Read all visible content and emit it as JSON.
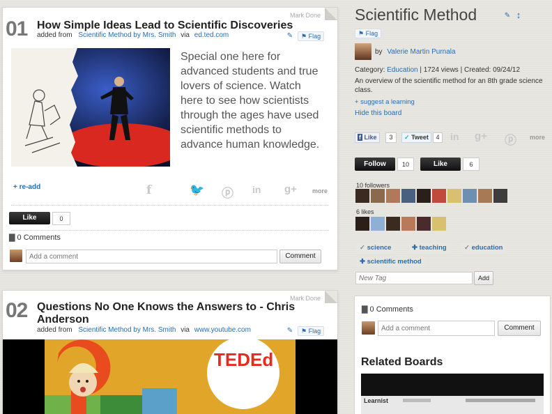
{
  "card1": {
    "mark_done": "Mark Done",
    "number": "01",
    "title": "How Simple Ideas Lead to Scientific Discoveries",
    "added_prefix": "added from",
    "source_board": "Scientific Method by Mrs. Smith",
    "via": "via",
    "source_site": "ed.ted.com",
    "flag": "Flag",
    "description": "Special one here for advanced students and true lovers of science.  Watch here to see how scientists through the ages have used scientific methods to advance human knowledge.",
    "readd": "+ re-add",
    "more": "more",
    "like_label": "Like",
    "like_count": "0",
    "comments": "0 Comments",
    "comment_placeholder": "Add a comment",
    "comment_button": "Comment"
  },
  "card2": {
    "mark_done": "Mark Done",
    "number": "02",
    "title": "Questions No One Knows the Answers to - Chris Anderson",
    "added_prefix": "added from",
    "source_board": "Scientific Method by Mrs. Smith",
    "via": "via",
    "source_site": "www.youtube.com",
    "flag": "Flag",
    "video_logo": "TEDEd"
  },
  "sidebar": {
    "title": "Scientific Method",
    "flag": "Flag",
    "by": "by",
    "author": "Valerie Martin Purnala",
    "category_label": "Category:",
    "category": "Education",
    "views": "| 1724 views | Created: 09/24/12",
    "description": "An overview of the scientific method for an 8th grade science class.",
    "suggest": "+ suggest a learning",
    "hide": "Hide this board",
    "fb_like": "Like",
    "fb_count": "3",
    "tweet": "Tweet",
    "tweet_count": "4",
    "more": "more",
    "follow_label": "Follow",
    "follow_count": "10",
    "like_label": "Like",
    "like_count": "6",
    "followers_label": "10 followers",
    "likes_label": "6 likes",
    "tags": [
      "science",
      "teaching",
      "education",
      "scientific method"
    ],
    "tag_icons": [
      "check",
      "plus",
      "check",
      "plus"
    ],
    "new_tag_placeholder": "New Tag",
    "add_button": "Add",
    "comments": "0 Comments",
    "comment_placeholder": "Add a comment",
    "comment_button": "Comment",
    "related_title": "Related Boards",
    "related_logo": "Learnist"
  },
  "colors": {
    "link": "#2a6cb0",
    "dark_button": "#1a1a1a",
    "background": "#e8e6e1"
  }
}
